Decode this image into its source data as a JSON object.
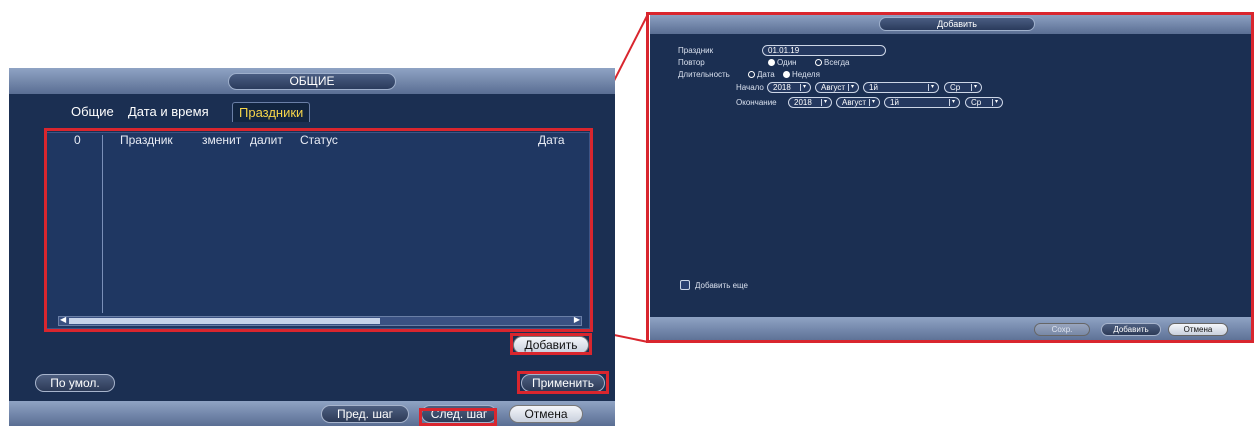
{
  "left": {
    "title": "ОБЩИЕ",
    "tabs": [
      "Общие",
      "Дата и время",
      "Праздники"
    ],
    "active_tab": "Праздники",
    "table": {
      "columns": [
        "0",
        "Праздник",
        "зменит",
        "далит",
        "Статус",
        "Дата"
      ]
    },
    "buttons": {
      "add": "Добавить",
      "default": "По умол.",
      "apply": "Применить",
      "prev": "Пред. шаг",
      "next": "След. шаг",
      "cancel": "Отмена"
    }
  },
  "right": {
    "title": "Добавить",
    "holiday_label": "Праздник",
    "holiday_value": "01.01.19",
    "repeat_label": "Повтор",
    "repeat_options": [
      "Один",
      "Всегда"
    ],
    "repeat_selected": "Один",
    "duration_label": "Длительность",
    "duration_options": [
      "Дата",
      "Неделя"
    ],
    "duration_selected": "Неделя",
    "start_label": "Начало",
    "start": {
      "year": "2018",
      "month": "Август",
      "week": "1й",
      "day": "Ср"
    },
    "end_label": "Окончание",
    "end": {
      "year": "2018",
      "month": "Август",
      "week": "1й",
      "day": "Ср"
    },
    "add_more_label": "Добавить еще",
    "buttons": {
      "save": "Сохр.",
      "add": "Добавить",
      "cancel": "Отмена"
    }
  },
  "colors": {
    "highlight": "#d9262e",
    "active_tab_text": "#f5d54a",
    "panel_bg": "#1b2f52"
  }
}
